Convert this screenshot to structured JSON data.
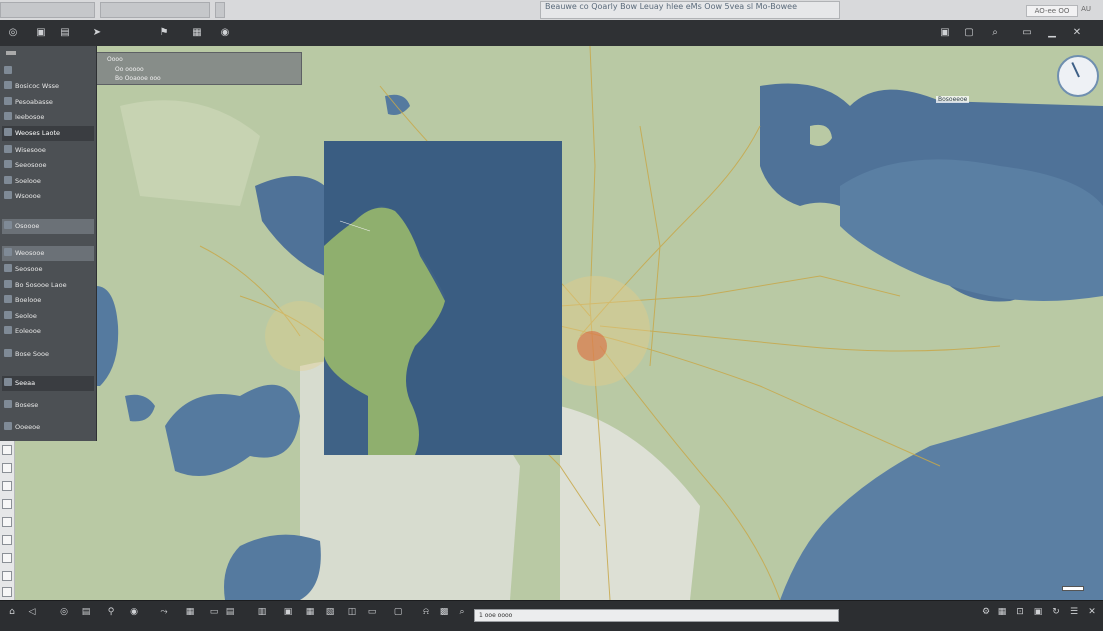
{
  "window": {
    "title_text": "Beauwe co Qoarly Bow Leuay hlee eMs Oow 5vea sl Mo-Bowee",
    "right_box": "AO-ee OO",
    "right_glyph": "AU"
  },
  "toolbar": {
    "icons": [
      "globe-icon",
      "square-icon",
      "layers-icon",
      "arrow-icon",
      "flag-icon",
      "grid-icon",
      "circle-icon",
      "square-icon",
      "square-icon"
    ]
  },
  "sidebar": {
    "items": [
      {
        "label": "Bosicoc Wsse",
        "selected": false,
        "header": false
      },
      {
        "label": "Pesoabasse",
        "selected": false,
        "header": false
      },
      {
        "label": "Ieebosoe",
        "selected": false,
        "header": false
      },
      {
        "label": "Weoses Laote",
        "selected": true,
        "header": true
      },
      {
        "label": "Wisesooe",
        "selected": false,
        "header": false
      },
      {
        "label": "Seeosooe",
        "selected": false,
        "header": false
      },
      {
        "label": "Soelooe",
        "selected": false,
        "header": false
      },
      {
        "label": "Wsoooe",
        "selected": false,
        "header": false
      },
      {
        "label": "Osoooe",
        "selected": true,
        "header": false
      },
      {
        "label": "Weosooe",
        "selected": true,
        "header": false
      },
      {
        "label": "Seosooe",
        "selected": false,
        "header": false
      },
      {
        "label": "Bo Sosooe Laoe",
        "selected": false,
        "header": false
      },
      {
        "label": "Boelooe",
        "selected": false,
        "header": false
      },
      {
        "label": "Seoloe",
        "selected": false,
        "header": false
      },
      {
        "label": "Eoleooe",
        "selected": false,
        "header": false
      },
      {
        "label": "Bose Sooe",
        "selected": false,
        "header": false
      },
      {
        "label": "Seeaa",
        "selected": false,
        "header": false
      },
      {
        "label": "Bosese",
        "selected": false,
        "header": false
      },
      {
        "label": "Ooeeoe",
        "selected": false,
        "header": false
      }
    ]
  },
  "info_panel": {
    "line1": "Oooo",
    "line2": "Oo ooooo",
    "line3": "Bo Ooaooe ooo"
  },
  "map": {
    "water_color": "#4f7298",
    "land_color": "#b9c9a4",
    "overlay_color": "#3f6286",
    "label_north": "Bosoeeoe"
  },
  "statusbar": {
    "coordinates": "1 ooe oooo"
  }
}
